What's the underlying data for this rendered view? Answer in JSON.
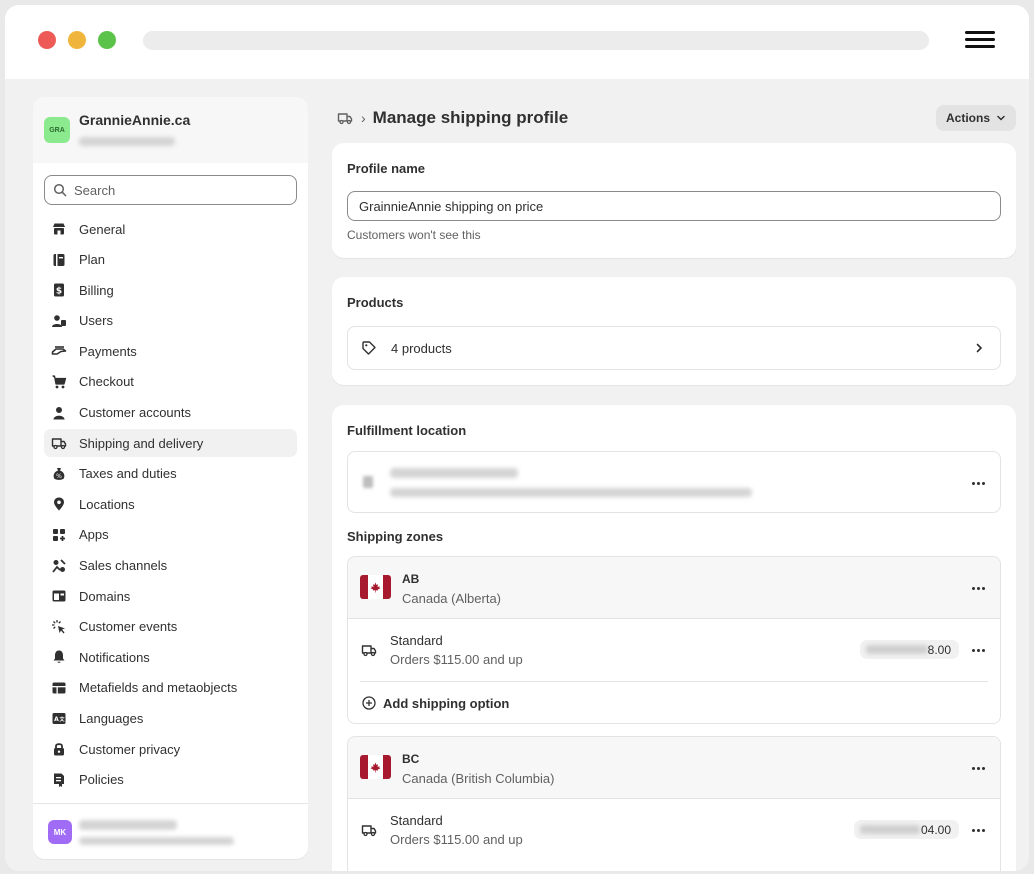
{
  "store": {
    "logo_text": "GRA",
    "name": "GrannieAnnie.ca"
  },
  "search": {
    "placeholder": "Search"
  },
  "sidebar": {
    "items": [
      {
        "label": "General",
        "icon": "store-icon"
      },
      {
        "label": "Plan",
        "icon": "plan-icon"
      },
      {
        "label": "Billing",
        "icon": "billing-icon"
      },
      {
        "label": "Users",
        "icon": "users-icon"
      },
      {
        "label": "Payments",
        "icon": "payments-icon"
      },
      {
        "label": "Checkout",
        "icon": "cart-icon"
      },
      {
        "label": "Customer accounts",
        "icon": "person-icon"
      },
      {
        "label": "Shipping and delivery",
        "icon": "truck-icon",
        "active": true
      },
      {
        "label": "Taxes and duties",
        "icon": "tax-icon"
      },
      {
        "label": "Locations",
        "icon": "location-icon"
      },
      {
        "label": "Apps",
        "icon": "apps-icon"
      },
      {
        "label": "Sales channels",
        "icon": "channels-icon"
      },
      {
        "label": "Domains",
        "icon": "domain-icon"
      },
      {
        "label": "Customer events",
        "icon": "cursor-icon"
      },
      {
        "label": "Notifications",
        "icon": "bell-icon"
      },
      {
        "label": "Metafields and metaobjects",
        "icon": "metafields-icon"
      },
      {
        "label": "Languages",
        "icon": "language-icon"
      },
      {
        "label": "Customer privacy",
        "icon": "lock-icon"
      },
      {
        "label": "Policies",
        "icon": "policy-icon"
      }
    ]
  },
  "user": {
    "avatar_text": "MK"
  },
  "header": {
    "title": "Manage shipping profile",
    "actions_label": "Actions"
  },
  "profile": {
    "title": "Profile name",
    "value": "GrainnieAnnie shipping on price",
    "help": "Customers won't see this"
  },
  "products": {
    "title": "Products",
    "count_label": "4 products"
  },
  "fulfillment": {
    "title": "Fulfillment location"
  },
  "shipping_zones": {
    "title": "Shipping zones",
    "zones": [
      {
        "code": "AB",
        "name": "Canada (Alberta)",
        "rate_name": "Standard",
        "rate_condition": "Orders $115.00 and up",
        "price_visible": "8.00",
        "add_label": "Add shipping option"
      },
      {
        "code": "BC",
        "name": "Canada (British Columbia)",
        "rate_name": "Standard",
        "rate_condition": "Orders $115.00 and up",
        "price_visible": "04.00"
      }
    ]
  },
  "colors": {
    "canada_red": "#a6192e",
    "store_logo_bg": "#8bea8e",
    "avatar_bg": "#a06cf6"
  }
}
